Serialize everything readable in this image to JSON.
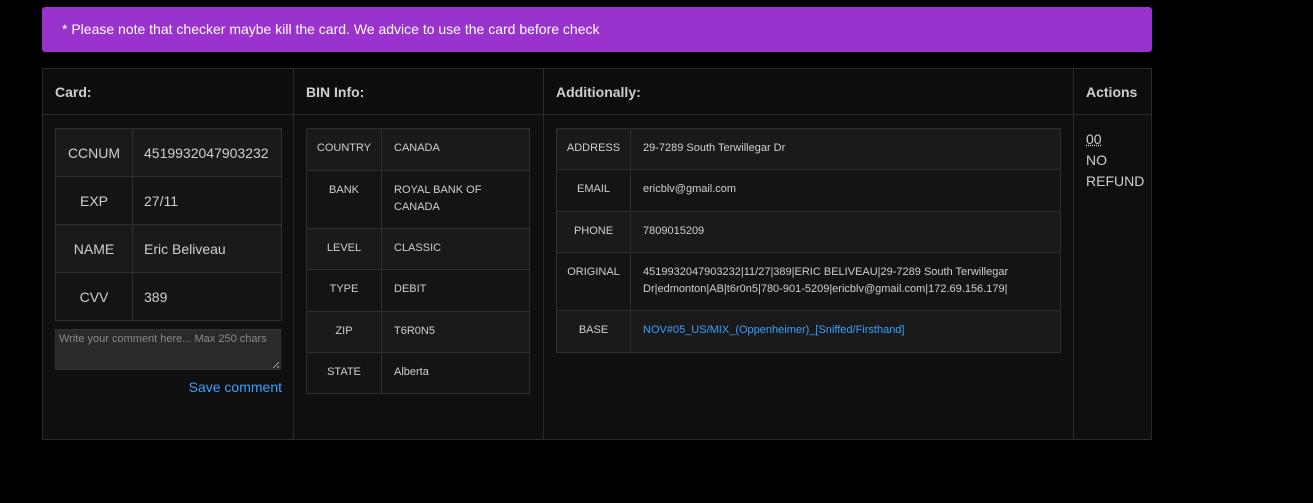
{
  "notice": "* Please note that checker maybe kill the card. We advice to use the card before check",
  "columns": {
    "card": "Card:",
    "bin": "BIN Info:",
    "additional": "Additionally:",
    "actions": "Actions"
  },
  "card": {
    "rows": [
      {
        "key": "CCNUM",
        "value": "4519932047903232"
      },
      {
        "key": "EXP",
        "value": "27/11"
      },
      {
        "key": "NAME",
        "value": "Eric Beliveau"
      },
      {
        "key": "CVV",
        "value": "389"
      }
    ],
    "comment_placeholder": "Write your comment here... Max 250 chars",
    "save_label": "Save comment"
  },
  "bin": {
    "rows": [
      {
        "key": "COUNTRY",
        "value": "CANADA"
      },
      {
        "key": "BANK",
        "value": "ROYAL BANK OF CANADA"
      },
      {
        "key": "LEVEL",
        "value": "CLASSIC"
      },
      {
        "key": "TYPE",
        "value": "DEBIT"
      },
      {
        "key": "ZIP",
        "value": "T6R0N5"
      },
      {
        "key": "STATE",
        "value": "Alberta"
      }
    ]
  },
  "additional": {
    "rows": [
      {
        "key": "ADDRESS",
        "value": "29-7289 South Terwillegar Dr"
      },
      {
        "key": "EMAIL",
        "value": "ericblv@gmail.com"
      },
      {
        "key": "PHONE",
        "value": "7809015209"
      },
      {
        "key": "ORIGINAL",
        "value": "4519932047903232|11/27|389|ERIC BELIVEAU|29-7289 South Terwillegar Dr|edmonton|AB|t6r0n5|780-901-5209|ericblv@gmail.com|172.69.156.179|"
      },
      {
        "key": "BASE",
        "value": "NOV#05_US/MIX_(Oppenheimer)_[Sniffed/Firsthand]"
      }
    ]
  },
  "actions": {
    "timer": "00",
    "status": "NO REFUND"
  },
  "colors": {
    "notice_bg": "#9a32cd",
    "link": "#3aa0ff",
    "background": "#000000"
  }
}
